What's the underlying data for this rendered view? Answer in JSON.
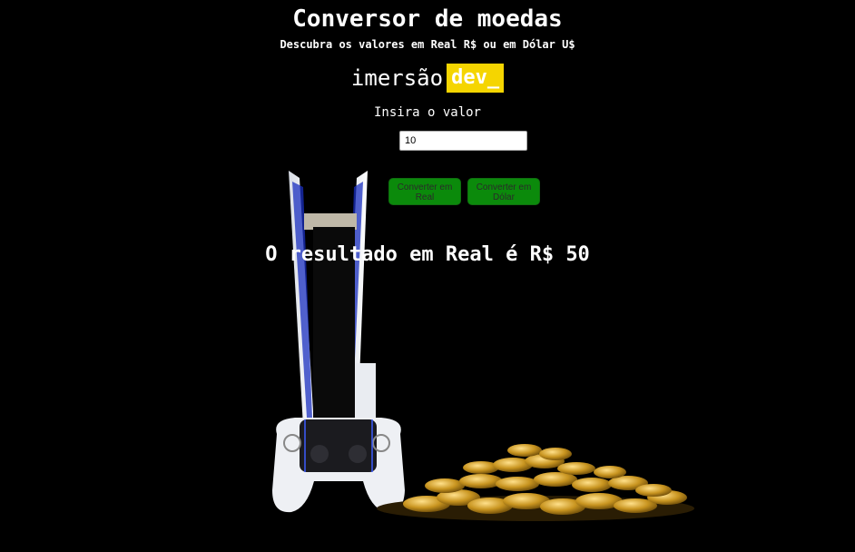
{
  "header": {
    "title": "Conversor de moedas",
    "subtitle": "Descubra os valores em Real R$ ou em Dólar U$"
  },
  "logo": {
    "word": "imersão",
    "badge": "dev_"
  },
  "form": {
    "label": "Insira o valor",
    "input_value": "10",
    "buttons": {
      "real": "Converter em Real",
      "dolar": "Converter em Dólar"
    }
  },
  "result": {
    "text": "O resultado em Real é R$ 50"
  },
  "colors": {
    "background": "#000000",
    "button": "#0b8a0b",
    "badge": "#f5d500"
  },
  "icons": {
    "console": "game-console-image",
    "controller": "game-controller-image",
    "coins": "gold-coins-image"
  }
}
